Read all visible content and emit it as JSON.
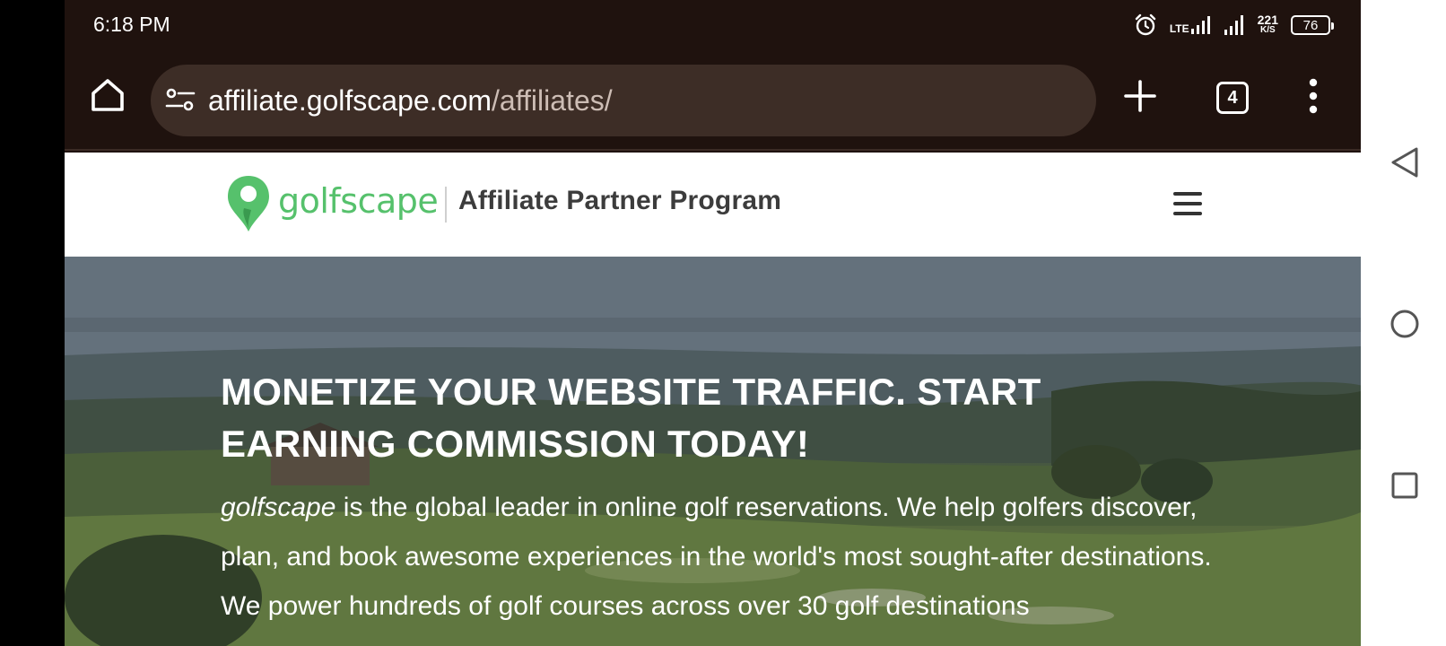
{
  "status_bar": {
    "time": "6:18 PM",
    "network_label": "LTE",
    "speed_value": "221",
    "speed_unit": "K/S",
    "battery": "76"
  },
  "browser": {
    "url_host": "affiliate.golfscape.com",
    "url_path": "/affiliates/",
    "tab_count": "4"
  },
  "site": {
    "logo_text": "golfscape",
    "program_title": "Affiliate Partner Program",
    "brand_color": "#56c16c"
  },
  "hero": {
    "heading": "MONETIZE YOUR WEBSITE TRAFFIC. START EARNING COMMISSION TODAY!",
    "body_brand": "golfscape",
    "body_text": " is the global leader in online golf reservations. We help golfers discover, plan, and book awesome experiences in the world's most sought-after destinations. We power hundreds of golf courses across over 30 golf destinations"
  },
  "icons": {
    "home": "home-icon",
    "site_settings": "tune-icon",
    "new_tab": "plus-icon",
    "tabs": "tab-switcher-icon",
    "menu": "more-vert-icon",
    "hamburger": "hamburger-menu-icon",
    "nav_back": "back-triangle-icon",
    "nav_home": "home-circle-icon",
    "nav_recent": "recents-square-icon"
  }
}
